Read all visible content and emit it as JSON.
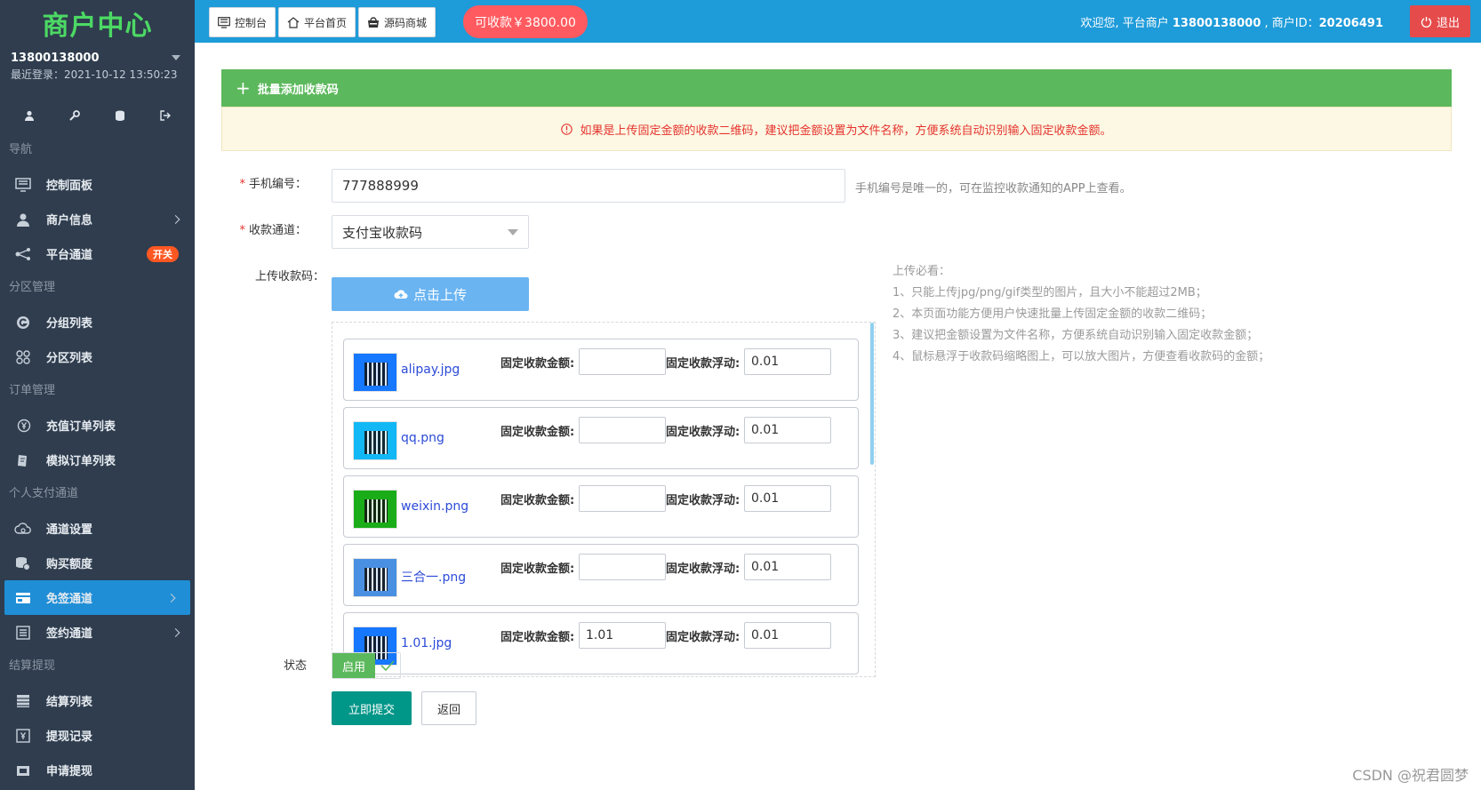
{
  "colors": {
    "sidebar_bg": "#2f3d4e",
    "topbar_bg": "#1e9bd9",
    "active_nav": "#1f8ed6",
    "brand_green": "#4cd964",
    "submit": "#009688",
    "panel_green": "#5cb85c",
    "logout_red": "#e54b4b",
    "balance_red": "#ff5a5f"
  },
  "sidebar": {
    "brand": "商户中心",
    "user": "13800138000",
    "last_login": "最近登录：2021-10-12 13:50:23",
    "quick_icons": [
      "user-icon",
      "key-icon",
      "database-icon",
      "exit-icon"
    ],
    "sections": [
      {
        "title": "导航",
        "items": [
          {
            "label": "控制面板",
            "icon": "monitor-icon"
          },
          {
            "label": "商户信息",
            "icon": "user-icon",
            "arrow": true
          },
          {
            "label": "平台通道",
            "icon": "network-icon",
            "badge": "开关"
          }
        ]
      },
      {
        "title": "分区管理",
        "items": [
          {
            "label": "分组列表",
            "icon": "g-circle-icon"
          },
          {
            "label": "分区列表",
            "icon": "grid-circles-icon"
          }
        ]
      },
      {
        "title": "订单管理",
        "items": [
          {
            "label": "充值订单列表",
            "icon": "yen-circle-icon"
          },
          {
            "label": "模拟订单列表",
            "icon": "note-icon"
          }
        ]
      },
      {
        "title": "个人支付通道",
        "items": [
          {
            "label": "通道设置",
            "icon": "cloud-gear-icon"
          },
          {
            "label": "购买额度",
            "icon": "coins-icon"
          },
          {
            "label": "免签通道",
            "icon": "card-icon",
            "arrow": true,
            "active": true
          },
          {
            "label": "签约通道",
            "icon": "list-icon",
            "arrow": true
          }
        ]
      },
      {
        "title": "结算提现",
        "items": [
          {
            "label": "结算列表",
            "icon": "table-icon"
          },
          {
            "label": "提现记录",
            "icon": "wallet-icon"
          },
          {
            "label": "申请提现",
            "icon": "cash-icon"
          }
        ]
      }
    ]
  },
  "topbar": {
    "buttons": [
      {
        "label": "控制台",
        "icon": "dashboard-icon"
      },
      {
        "label": "平台首页",
        "icon": "home-icon"
      },
      {
        "label": "源码商城",
        "icon": "shop-icon"
      }
    ],
    "balance": "可收款￥3800.00",
    "welcome_prefix": "欢迎您, 平台商户 ",
    "merchant": "13800138000",
    "id_label": " , 商户ID：",
    "merchant_id": "20206491",
    "logout": "退出"
  },
  "panel": {
    "title": "批量添加收款码",
    "notice": "如果是上传固定金额的收款二维码，建议把金额设置为文件名称，方便系统自动识别输入固定收款金额。"
  },
  "form": {
    "phone_label": "手机编号：",
    "phone_value": "777888999",
    "phone_hint": "手机编号是唯一的，可在监控收款通知的APP上查看。",
    "channel_label": "收款通道：",
    "channel_value": "支付宝收款码",
    "upload_label": "上传收款码：",
    "upload_button": "点击上传",
    "amount_label": "固定收款金额:",
    "float_label": "固定收款浮动:",
    "files": [
      {
        "name": "alipay.jpg",
        "amount": "",
        "float": "0.01",
        "thumb_color": "#1677ff"
      },
      {
        "name": "qq.png",
        "amount": "",
        "float": "0.01",
        "thumb_color": "#12b7f5"
      },
      {
        "name": "weixin.png",
        "amount": "",
        "float": "0.01",
        "thumb_color": "#1aad19"
      },
      {
        "name": "三合一.png",
        "amount": "",
        "float": "0.01",
        "thumb_color": "#4a90e2"
      },
      {
        "name": "1.01.jpg",
        "amount": "1.01",
        "float": "0.01",
        "thumb_color": "#1677ff"
      }
    ],
    "tips": [
      "上传必看：",
      "1、只能上传jpg/png/gif类型的图片，且大小不能超过2MB；",
      "2、本页面功能方便用户快速批量上传固定金额的收款二维码；",
      "3、建议把金额设置为文件名称，方便系统自动识别输入固定收款金额；",
      "4、鼠标悬浮于收款码缩略图上，可以放大图片，方便查看收款码的金额；"
    ],
    "status_label": "状态",
    "status_value": "启用",
    "submit": "立即提交",
    "back": "返回"
  },
  "watermark": "CSDN @祝君圆梦"
}
